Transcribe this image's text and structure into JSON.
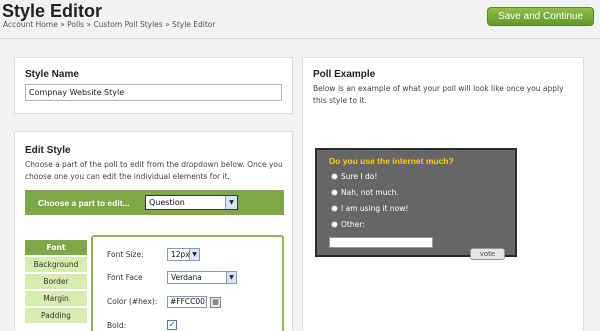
{
  "header": {
    "title": "Style Editor",
    "breadcrumb": "Account Home » Polls » Custom Poll Styles » Style Editor",
    "save_label": "Save and Continue"
  },
  "style_name": {
    "title": "Style Name",
    "value": "Compnay Website Style"
  },
  "edit_style": {
    "title": "Edit Style",
    "description": "Choose a part of the poll to edit from the dropdown below. Once you choose one you can edit the individual elements for it.",
    "choose_label": "Choose a part to edit...",
    "selected_part": "Question",
    "tabs": [
      {
        "label": "Font",
        "active": true
      },
      {
        "label": "Background",
        "active": false
      },
      {
        "label": "Border",
        "active": false
      },
      {
        "label": "Margin",
        "active": false
      },
      {
        "label": "Padding",
        "active": false
      }
    ],
    "properties": {
      "font_size_label": "Font Size:",
      "font_size_value": "12px",
      "font_face_label": "Font Face",
      "font_face_value": "Verdana",
      "color_label": "Color (#hex):",
      "color_value": "#FFCC00",
      "bold_label": "Bold:",
      "bold_checked": true
    }
  },
  "poll_example": {
    "title": "Poll Example",
    "description": "Below is an example of what your poll will look like once you apply this style to it.",
    "question": "Do you use the internet much?",
    "options": [
      "Sure I do!",
      "Nah, not much.",
      "I am using it now!",
      "Other:"
    ],
    "vote_label": "vote",
    "colors": {
      "background": "#666666",
      "question": "#FFCC00",
      "accent": "#7EA846"
    }
  }
}
